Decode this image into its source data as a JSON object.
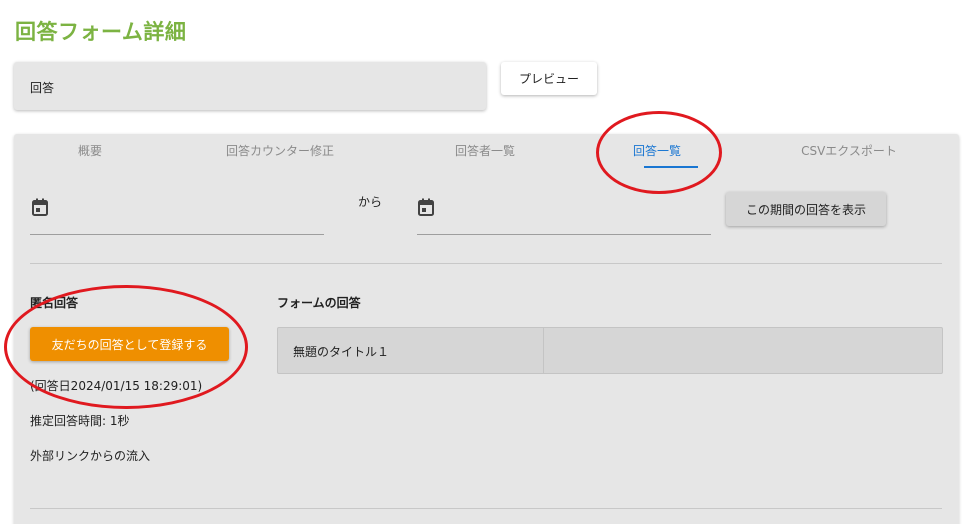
{
  "header": {
    "title": "回答フォーム詳細"
  },
  "form": {
    "name": "回答",
    "preview_label": "プレビュー"
  },
  "tabs": [
    {
      "label": "概要",
      "active": false
    },
    {
      "label": "回答カウンター修正",
      "active": false
    },
    {
      "label": "回答者一覧",
      "active": false
    },
    {
      "label": "回答一覧",
      "active": true
    },
    {
      "label": "CSVエクスポート",
      "active": false
    }
  ],
  "date_filter": {
    "from_value": "",
    "to_value": "",
    "separator": "から",
    "show_button_label": "この期間の回答を表示"
  },
  "respondent": {
    "heading": "匿名回答",
    "register_button_label": "友だちの回答として登録する",
    "answer_date": "(回答日2024/01/15 18:29:01)",
    "estimated_time": "推定回答時間: 1秒",
    "source": "外部リンクからの流入"
  },
  "answers": {
    "heading": "フォームの回答",
    "rows": [
      {
        "question": "無題のタイトル１",
        "answer": ""
      }
    ]
  },
  "colors": {
    "title_green": "#7cb342",
    "tab_active_blue": "#1976d2",
    "register_orange": "#ef8f00",
    "annotation_red": "#e0191f"
  }
}
